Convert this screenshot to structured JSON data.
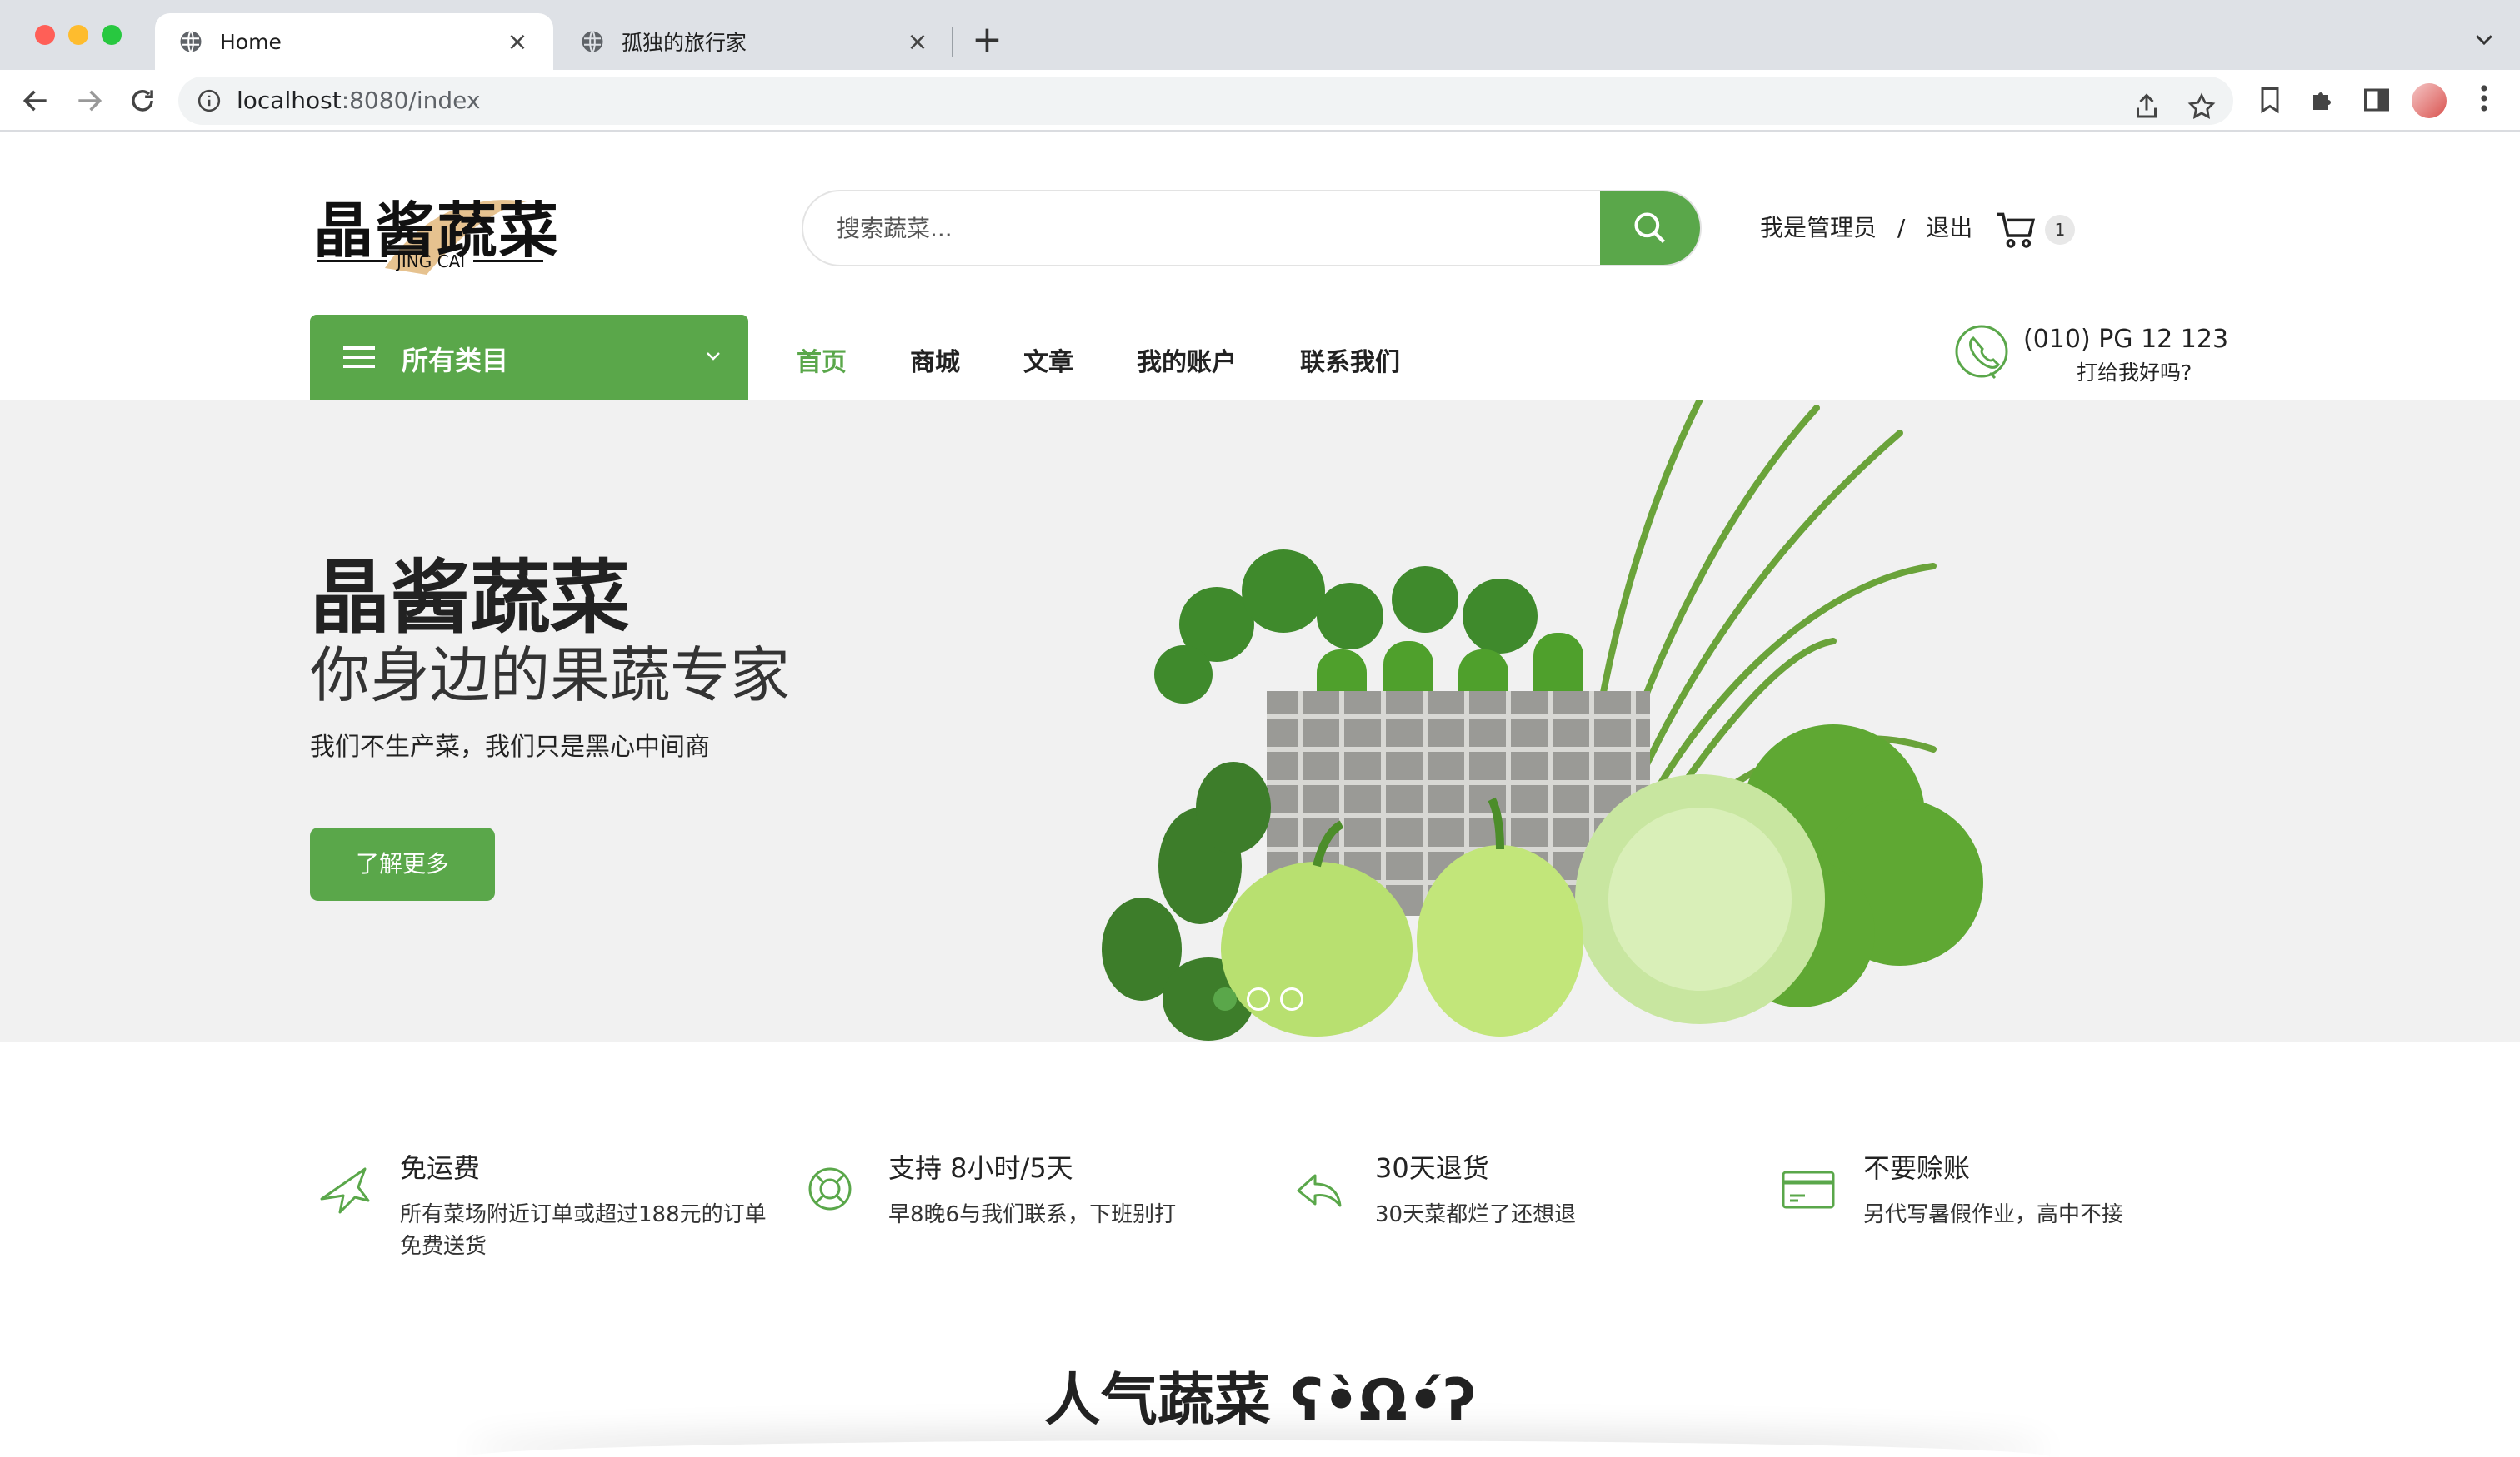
{
  "browser": {
    "tabs": [
      {
        "title": "Home",
        "active": true
      },
      {
        "title": "孤独的旅行家",
        "active": false
      }
    ],
    "url_host": "localhost",
    "url_path": ":8080/index"
  },
  "header": {
    "logo_text": "晶酱蔬菜",
    "logo_sub": "JING CAI",
    "search_placeholder": "搜索蔬菜...",
    "user_label": "我是管理员",
    "separator": "/",
    "logout_label": "退出",
    "cart_count": "1"
  },
  "nav": {
    "categories_label": "所有类目",
    "items": [
      {
        "label": "首页",
        "active": true
      },
      {
        "label": "商城",
        "active": false
      },
      {
        "label": "文章",
        "active": false
      },
      {
        "label": "我的账户",
        "active": false
      },
      {
        "label": "联系我们",
        "active": false
      }
    ],
    "phone": "(010) PG 12 123",
    "phone_sub": "打给我好吗?"
  },
  "hero": {
    "title": "晶酱蔬菜",
    "subtitle": "你身边的果蔬专家",
    "description": "我们不生产菜，我们只是黑心中间商",
    "button": "了解更多",
    "slide_count": 3,
    "active_slide": 1
  },
  "features": [
    {
      "icon": "airplane-icon",
      "title": "免运费",
      "desc": "所有菜场附近订单或超过188元的订单免费送货"
    },
    {
      "icon": "lifebuoy-icon",
      "title": "支持 8小时/5天",
      "desc": "早8晚6与我们联系，下班别打"
    },
    {
      "icon": "return-arrow-icon",
      "title": "30天退货",
      "desc": "30天菜都烂了还想退"
    },
    {
      "icon": "credit-card-icon",
      "title": "不要赊账",
      "desc": "另代写暑假作业，高中不接"
    }
  ],
  "popular": {
    "title": "人气蔬菜 ʕ•̀Ω•́ʔ"
  },
  "colors": {
    "accent": "#5aa74a",
    "hero_bg": "#f1f1f1",
    "tabstrip_bg": "#dee1e6"
  }
}
